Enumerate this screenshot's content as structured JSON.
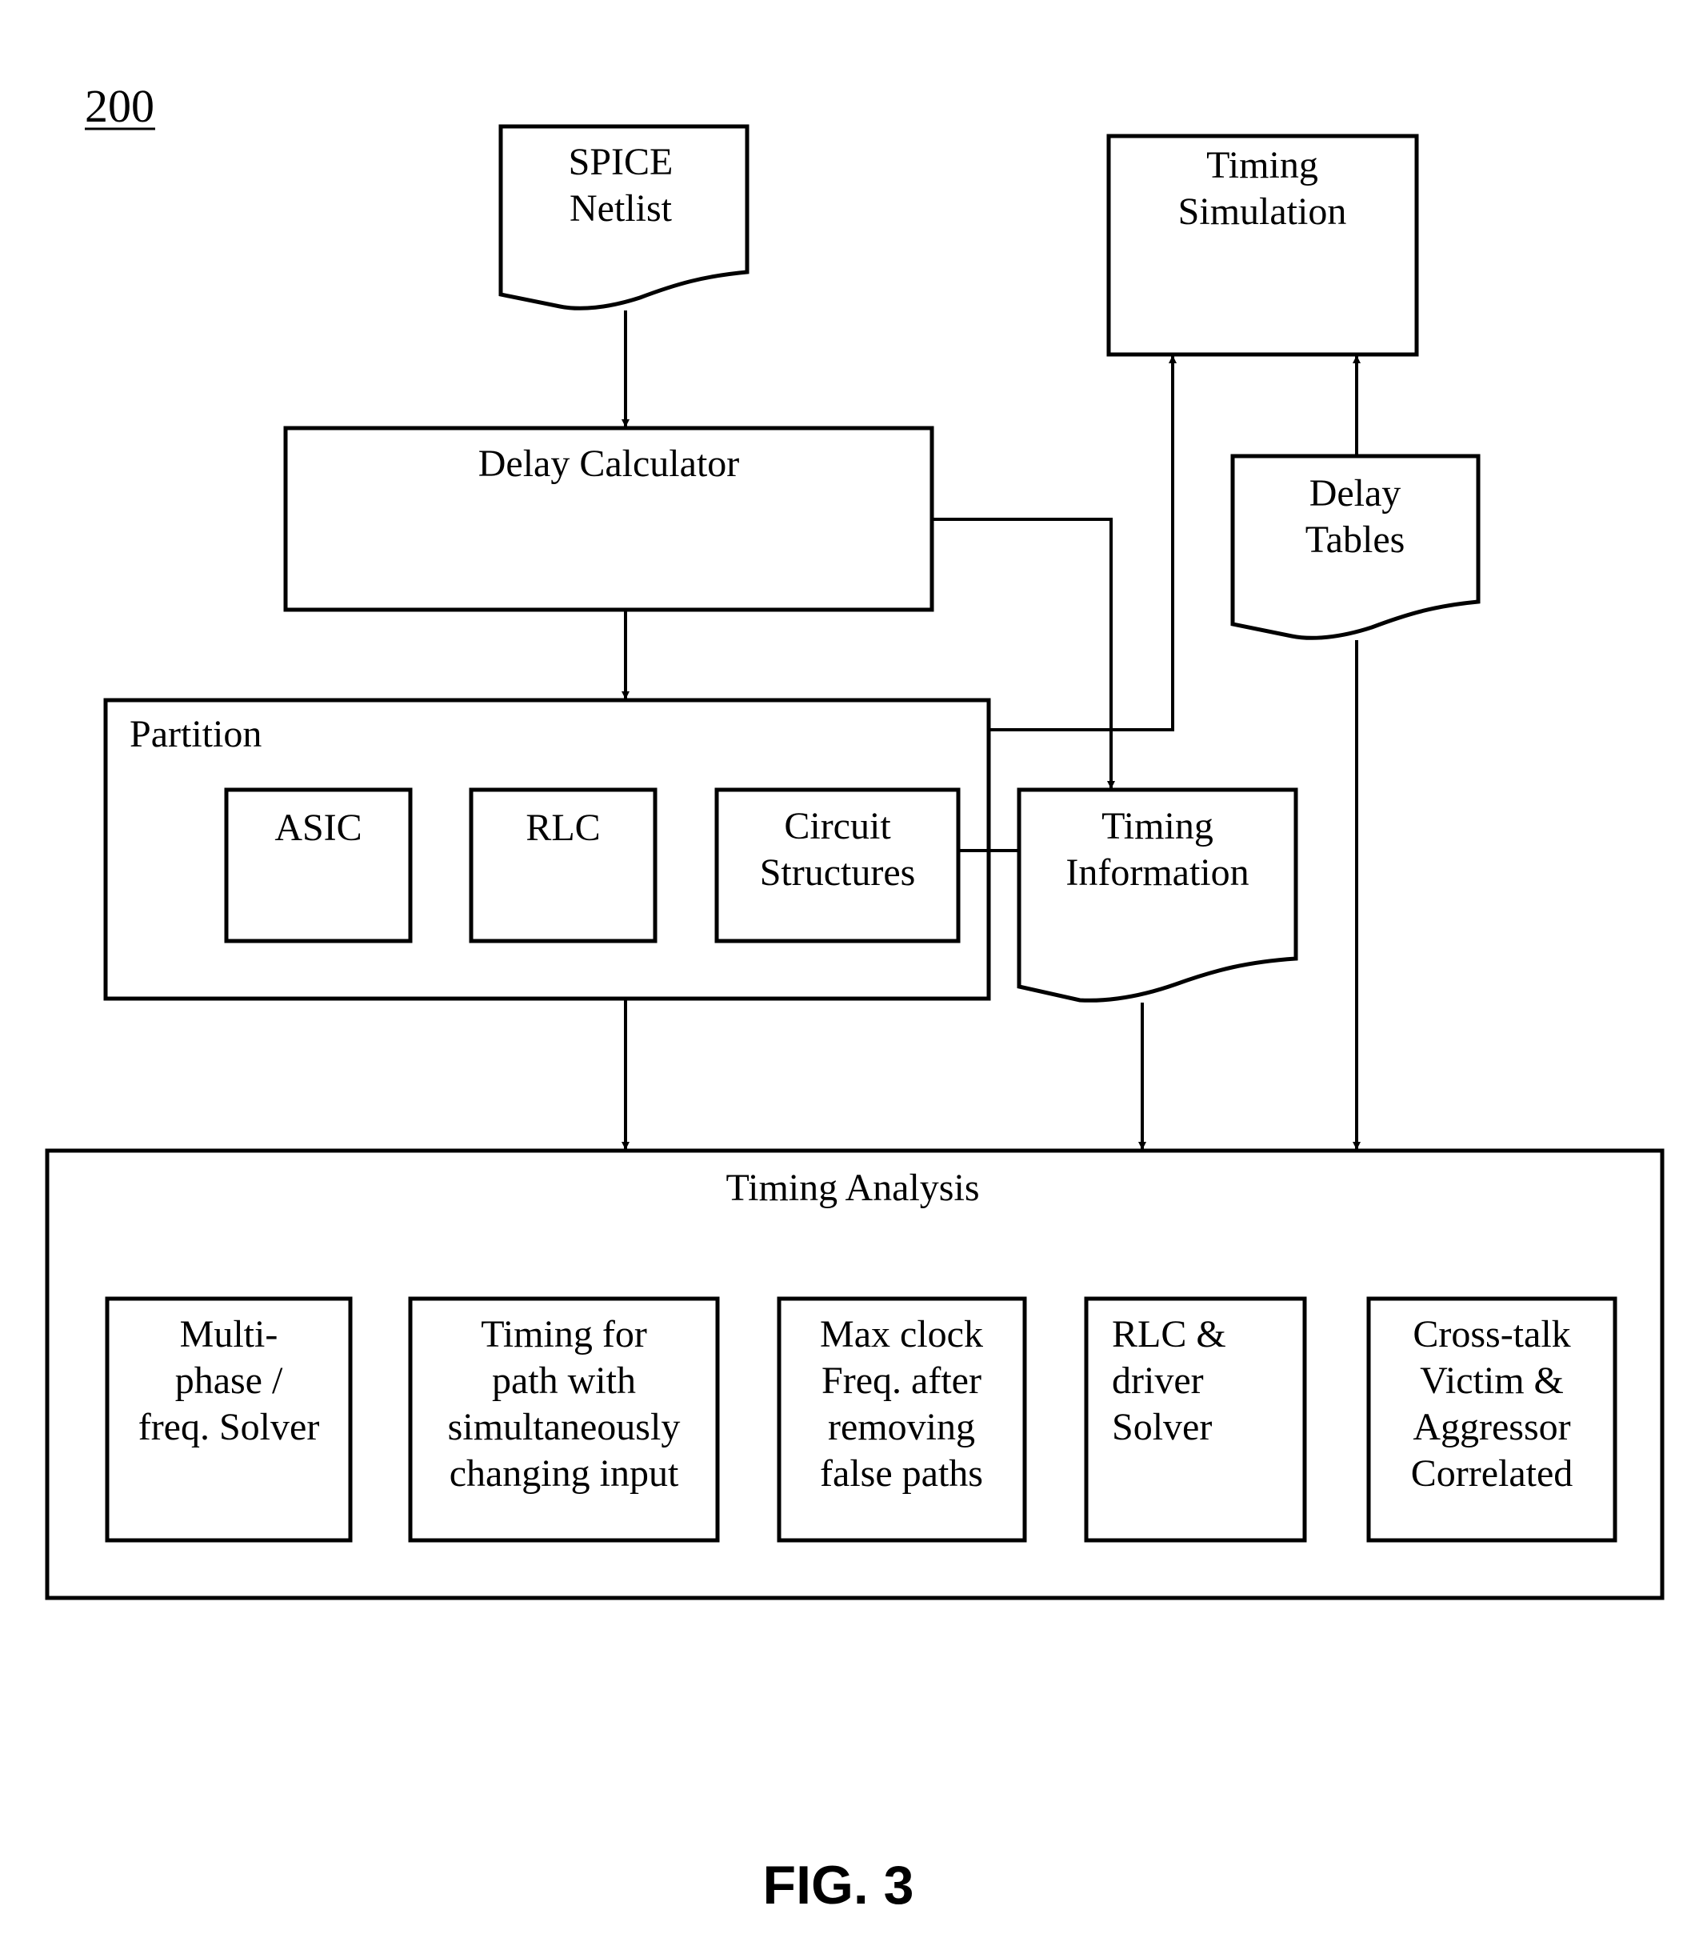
{
  "figure": {
    "reference_number": "200",
    "caption": "FIG. 3"
  },
  "nodes": {
    "spice_netlist": {
      "shape": "document",
      "lines": [
        "SPICE",
        "Netlist"
      ]
    },
    "timing_simulation": {
      "shape": "box",
      "lines": [
        "Timing",
        "Simulation"
      ]
    },
    "delay_calculator": {
      "shape": "box",
      "lines": [
        "Delay Calculator"
      ]
    },
    "delay_tables": {
      "shape": "document",
      "lines": [
        "Delay",
        "Tables"
      ]
    },
    "partition": {
      "shape": "box",
      "title": "Partition",
      "children": [
        {
          "id": "asic",
          "lines": [
            "ASIC"
          ]
        },
        {
          "id": "rlc",
          "lines": [
            "RLC"
          ]
        },
        {
          "id": "circuit_structures",
          "lines": [
            "Circuit",
            "Structures"
          ]
        }
      ]
    },
    "timing_information": {
      "shape": "document",
      "lines": [
        "Timing",
        "Information"
      ]
    },
    "timing_analysis": {
      "shape": "box",
      "title": "Timing Analysis",
      "children": [
        {
          "id": "multi_phase",
          "lines": [
            "Multi-",
            "phase /",
            "freq. Solver"
          ]
        },
        {
          "id": "timing_for_path",
          "lines": [
            "Timing for",
            "path with",
            "simultaneously",
            "changing input"
          ]
        },
        {
          "id": "max_clock",
          "lines": [
            "Max clock",
            "Freq. after",
            "removing",
            "false paths"
          ]
        },
        {
          "id": "rlc_driver",
          "lines": [
            "RLC &",
            "driver",
            "Solver"
          ]
        },
        {
          "id": "cross_talk",
          "lines": [
            "Cross-talk",
            "Victim &",
            "Aggressor",
            "Correlated"
          ]
        }
      ]
    }
  },
  "edges": [
    {
      "from": "spice_netlist",
      "to": "delay_calculator",
      "arrow": "end"
    },
    {
      "from": "delay_calculator",
      "to": "partition",
      "arrow": "end"
    },
    {
      "from": "delay_calculator",
      "to": "timing_information",
      "arrow": "end"
    },
    {
      "from": "partition",
      "to": "timing_simulation",
      "arrow": "end"
    },
    {
      "from": "delay_tables",
      "to": "timing_simulation",
      "arrow": "end"
    },
    {
      "from": "circuit_structures",
      "to": "timing_information",
      "arrow": "none"
    },
    {
      "from": "partition",
      "to": "timing_analysis",
      "arrow": "end"
    },
    {
      "from": "timing_information",
      "to": "timing_analysis",
      "arrow": "end"
    },
    {
      "from": "delay_tables",
      "to": "timing_analysis",
      "arrow": "end"
    }
  ]
}
